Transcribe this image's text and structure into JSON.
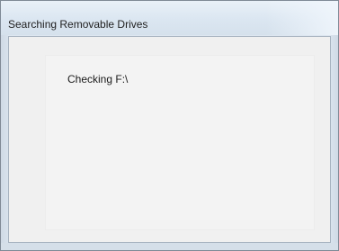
{
  "window": {
    "title": "Searching Removable Drives"
  },
  "content": {
    "status": "Checking F:\\"
  },
  "colors": {
    "title_text": "#1f1f1f",
    "frame": "#d8e2ec",
    "client_background": "#f0f0f0"
  }
}
